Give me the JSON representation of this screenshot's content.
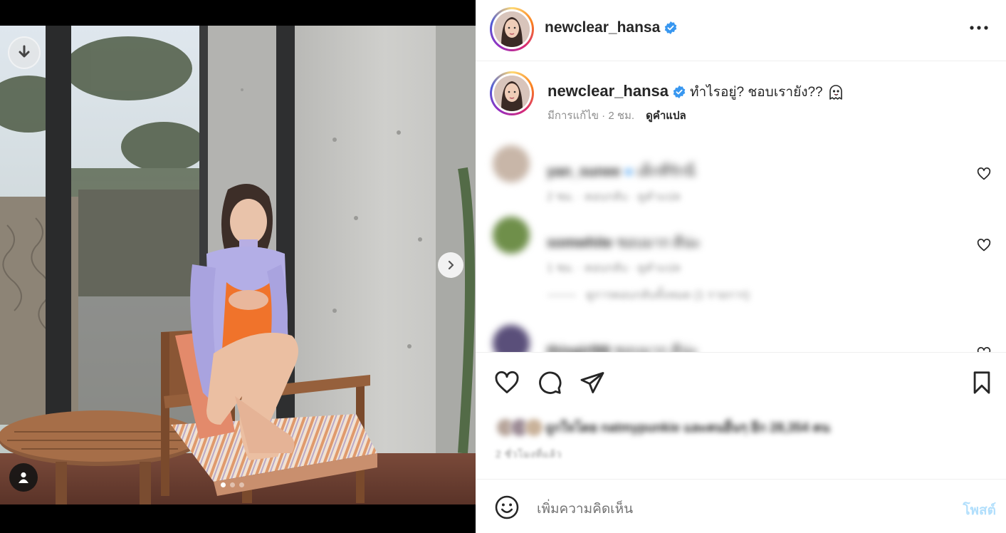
{
  "post": {
    "username": "newclear_hansa",
    "verified": true,
    "caption": "ทำไรอยู่? ชอบเรายัง??",
    "caption_emoji": "ghost-emoji",
    "edited_label": "มีการแก้ไข · 2 ชม.",
    "translate_label": "ดูคำแปล"
  },
  "media": {
    "carousel_count": 3,
    "carousel_active_index": 0,
    "icons": {
      "download": "download-icon",
      "next": "chevron-right-icon",
      "tag": "user-tag-icon"
    }
  },
  "comments": [
    {
      "username": "yan_sunee",
      "verified": true,
      "text": "เด็กที่รักนี่",
      "meta": "2 ชม. · ตอบกลับ · ดูคำแปล"
    },
    {
      "username": "somwhite",
      "verified": false,
      "text": "ชอบมาก ดีน่ะ",
      "meta": "1 ชม. · ตอบกลับ · ดูคำแปล",
      "replies_label": "ดูการตอบกลับทั้งหมด (1 รายการ)"
    },
    {
      "username": "thisgirl99",
      "verified": false,
      "text": "ชอบมาก ดีน่ะ",
      "meta": ""
    }
  ],
  "likes": {
    "text": "ถูกใจโดย natmypunkie และคนอื่นๆ อีก 28,354 คน"
  },
  "post_time": "2 ชั่วโมงที่แล้ว",
  "composer": {
    "placeholder": "เพิ่มความคิดเห็น",
    "post_label": "โพสต์"
  },
  "colors": {
    "accent_disabled": "#b2dffc",
    "verified_blue": "#3897f0",
    "muted_text": "#8e8e8e"
  }
}
